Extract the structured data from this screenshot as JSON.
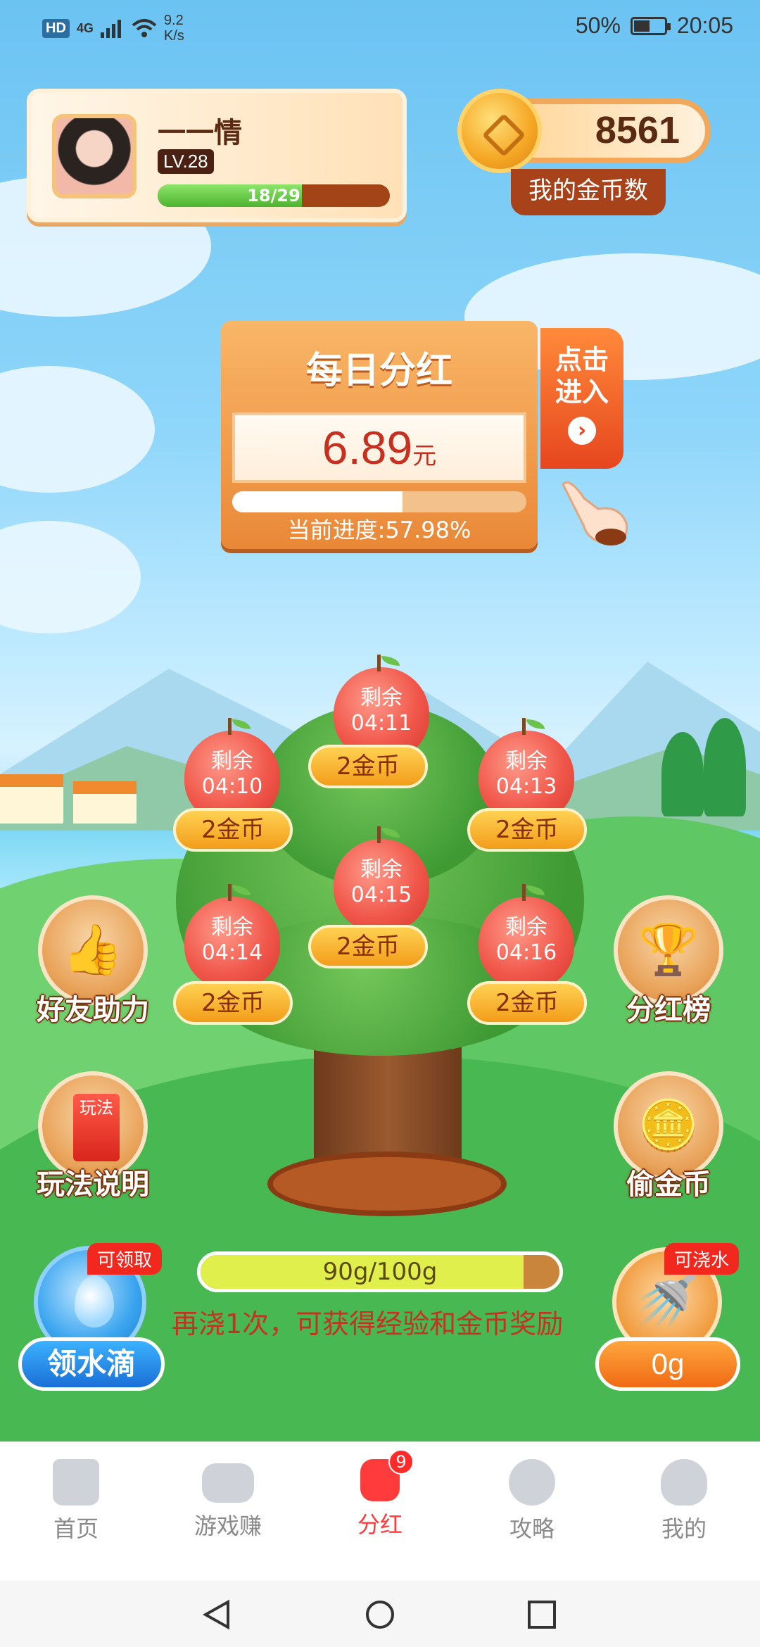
{
  "status_bar": {
    "network_label": "HD",
    "signal_label": "4G",
    "speed_value": "9.2",
    "speed_unit": "K/s",
    "battery": "50%",
    "time": "20:05"
  },
  "profile": {
    "name": "一一情",
    "level": "LV.28",
    "xp_text": "18/29",
    "xp_fraction": 0.62
  },
  "coins": {
    "amount": "8561",
    "label": "我的金币数"
  },
  "dividend": {
    "title": "每日分红",
    "amount": "6.89",
    "unit": "元",
    "progress_text": "当前进度:57.98%",
    "progress_percent": 57.98,
    "enter_label_1": "点击",
    "enter_label_2": "进入",
    "enter_arrow": "›"
  },
  "apples": [
    {
      "label": "剩余",
      "time": "04:11",
      "reward": "2金币"
    },
    {
      "label": "剩余",
      "time": "04:10",
      "reward": "2金币"
    },
    {
      "label": "剩余",
      "time": "04:13",
      "reward": "2金币"
    },
    {
      "label": "剩余",
      "time": "04:15",
      "reward": "2金币"
    },
    {
      "label": "剩余",
      "time": "04:14",
      "reward": "2金币"
    },
    {
      "label": "剩余",
      "time": "04:16",
      "reward": "2金币"
    }
  ],
  "side_buttons": {
    "friend_help": "好友助力",
    "dividend_rank": "分红榜",
    "rules": "玩法说明",
    "steal_coins": "偷金币",
    "rules_book_text": "玩法"
  },
  "water": {
    "tag": "可领取",
    "button": "领水滴",
    "bar_text": "90g/100g",
    "bar_fraction": 0.9,
    "hint": "再浇1次，可获得经验和金币奖励",
    "can_tag": "可浇水",
    "can_amount": "0g"
  },
  "bottom_nav": [
    {
      "label": "首页"
    },
    {
      "label": "游戏赚"
    },
    {
      "label": "分红",
      "badge": "9"
    },
    {
      "label": "攻略"
    },
    {
      "label": "我的"
    }
  ]
}
